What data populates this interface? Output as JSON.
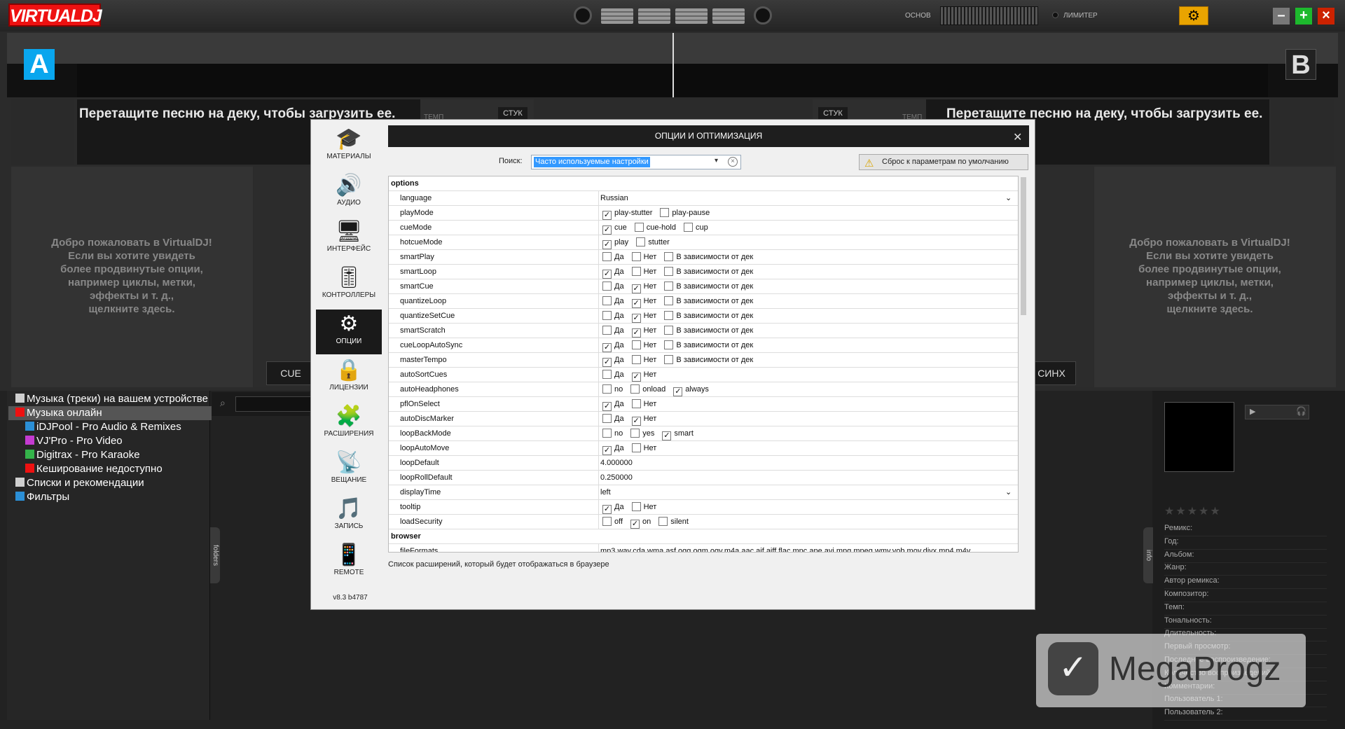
{
  "app": {
    "logo": "VIRTUALDJ",
    "master_label": "ОСНОВ",
    "limiter_label": "ЛИМИТЕР"
  },
  "decks": {
    "a_label": "A",
    "b_label": "B",
    "drag_text": "Перетащите песню на деку, чтобы загрузить ее.",
    "tempo_label": "ТЕМП",
    "stuck_label": "СТУК",
    "welcome_text": [
      "Добро пожаловать в VirtualDJ!",
      "Если вы хотите увидеть",
      "более продвинутые опции,",
      "например циклы, метки,",
      "эффекты и т. д.,",
      "щелкните здесь."
    ],
    "cue_label": "CUE",
    "sync_label": "СИНХ"
  },
  "browser": {
    "tree": [
      {
        "label": "Музыка (треки) на вашем устройстве",
        "color": "#cfcfcf"
      },
      {
        "label": "Музыка онлайн",
        "color": "#e11",
        "selected": true
      },
      {
        "label": "iDJPool - Pro Audio & Remixes",
        "color": "#2b8fd6"
      },
      {
        "label": "VJ'Pro - Pro Video",
        "color": "#c43bd1"
      },
      {
        "label": "Digitrax - Pro Karaoke",
        "color": "#34b34a"
      },
      {
        "label": "Кеширование недоступно",
        "color": "#e11"
      },
      {
        "label": "Списки и рекомендации",
        "color": "#cfcfcf"
      },
      {
        "label": "Фильтры",
        "color": "#2b8fd6"
      }
    ],
    "folders_tab": "folders",
    "info_tab": "info"
  },
  "info_panel": {
    "fields": [
      "Ремикс:",
      "Год:",
      "Альбом:",
      "Жанр:",
      "Автор ремикса:",
      "Композитор:",
      "Темп:",
      "Тональность:",
      "Длительность:",
      "Первый просмотр:",
      "Последнее воспроизведение:",
      "Количество воспроизведений:",
      "Комментарии:",
      "Пользователь 1:",
      "Пользователь 2:"
    ]
  },
  "dialog": {
    "title": "ОПЦИИ И ОПТИМИЗАЦИЯ",
    "search_label": "Поиск:",
    "search_value": "Часто используемые настройки",
    "reset_label": "Сброс к параметрам по умолчанию",
    "sidebar": [
      {
        "label": "МАТЕРИАЛЫ",
        "icon": "graduation-cap-icon",
        "glyph": "🎓"
      },
      {
        "label": "АУДИО",
        "icon": "speaker-icon",
        "glyph": "🔊"
      },
      {
        "label": "ИНТЕРФЕЙС",
        "icon": "monitor-icon",
        "glyph": "🖥"
      },
      {
        "label": "КОНТРОЛЛЕРЫ",
        "icon": "mixer-sliders-icon",
        "glyph": "🎚"
      },
      {
        "label": "ОПЦИИ",
        "icon": "gear-icon",
        "glyph": "⚙",
        "active": true
      },
      {
        "label": "ЛИЦЕНЗИИ",
        "icon": "lock-icon",
        "glyph": "🔒"
      },
      {
        "label": "РАСШИРЕНИЯ",
        "icon": "puzzle-icon",
        "glyph": "🧩"
      },
      {
        "label": "ВЕЩАНИЕ",
        "icon": "broadcast-icon",
        "glyph": "📡"
      },
      {
        "label": "ЗАПИСЬ",
        "icon": "music-folder-icon",
        "glyph": "🎵"
      },
      {
        "label": "REMOTE",
        "icon": "phone-icon",
        "glyph": "📱"
      }
    ],
    "version": "v8.3 b4787",
    "rows": [
      {
        "type": "header",
        "key": "options"
      },
      {
        "key": "language",
        "text": "Russian",
        "dropdown": true
      },
      {
        "key": "playMode",
        "opts": [
          [
            "play-stutter",
            true
          ],
          [
            "play-pause",
            false
          ]
        ]
      },
      {
        "key": "cueMode",
        "opts": [
          [
            "cue",
            true
          ],
          [
            "cue-hold",
            false
          ],
          [
            "cup",
            false
          ]
        ]
      },
      {
        "key": "hotcueMode",
        "opts": [
          [
            "play",
            true
          ],
          [
            "stutter",
            false
          ]
        ]
      },
      {
        "key": "smartPlay",
        "opts": [
          [
            "Да",
            false
          ],
          [
            "Нет",
            false
          ],
          [
            "В зависимости от дек",
            false
          ]
        ]
      },
      {
        "key": "smartLoop",
        "opts": [
          [
            "Да",
            true
          ],
          [
            "Нет",
            false
          ],
          [
            "В зависимости от дек",
            false
          ]
        ]
      },
      {
        "key": "smartCue",
        "opts": [
          [
            "Да",
            false
          ],
          [
            "Нет",
            true
          ],
          [
            "В зависимости от дек",
            false
          ]
        ]
      },
      {
        "key": "quantizeLoop",
        "opts": [
          [
            "Да",
            false
          ],
          [
            "Нет",
            true
          ],
          [
            "В зависимости от дек",
            false
          ]
        ]
      },
      {
        "key": "quantizeSetCue",
        "opts": [
          [
            "Да",
            false
          ],
          [
            "Нет",
            true
          ],
          [
            "В зависимости от дек",
            false
          ]
        ]
      },
      {
        "key": "smartScratch",
        "opts": [
          [
            "Да",
            false
          ],
          [
            "Нет",
            true
          ],
          [
            "В зависимости от дек",
            false
          ]
        ]
      },
      {
        "key": "cueLoopAutoSync",
        "opts": [
          [
            "Да",
            true
          ],
          [
            "Нет",
            false
          ],
          [
            "В зависимости от дек",
            false
          ]
        ]
      },
      {
        "key": "masterTempo",
        "opts": [
          [
            "Да",
            true
          ],
          [
            "Нет",
            false
          ],
          [
            "В зависимости от дек",
            false
          ]
        ]
      },
      {
        "key": "autoSortCues",
        "opts": [
          [
            "Да",
            false
          ],
          [
            "Нет",
            true
          ]
        ]
      },
      {
        "key": "autoHeadphones",
        "opts": [
          [
            "no",
            false
          ],
          [
            "onload",
            false
          ],
          [
            "always",
            true
          ]
        ]
      },
      {
        "key": "pflOnSelect",
        "opts": [
          [
            "Да",
            true
          ],
          [
            "Нет",
            false
          ]
        ]
      },
      {
        "key": "autoDiscMarker",
        "opts": [
          [
            "Да",
            false
          ],
          [
            "Нет",
            true
          ]
        ]
      },
      {
        "key": "loopBackMode",
        "opts": [
          [
            "no",
            false
          ],
          [
            "yes",
            false
          ],
          [
            "smart",
            true
          ]
        ]
      },
      {
        "key": "loopAutoMove",
        "opts": [
          [
            "Да",
            true
          ],
          [
            "Нет",
            false
          ]
        ]
      },
      {
        "key": "loopDefault",
        "text": "4.000000"
      },
      {
        "key": "loopRollDefault",
        "text": "0.250000"
      },
      {
        "key": "displayTime",
        "text": "left",
        "dropdown": true
      },
      {
        "key": "tooltip",
        "opts": [
          [
            "Да",
            true
          ],
          [
            "Нет",
            false
          ]
        ]
      },
      {
        "key": "loadSecurity",
        "opts": [
          [
            "off",
            false
          ],
          [
            "on",
            true
          ],
          [
            "silent",
            false
          ]
        ]
      },
      {
        "type": "header",
        "key": "browser"
      },
      {
        "key": "fileFormats",
        "text": "mp3,wav,cda,wma,asf,ogg,ogm,ogv,m4a,aac,aif,aiff,flac,mpc,ape,avi,mpg,mpeg,wmv,vob,mov,divx,mp4,m4v"
      }
    ],
    "description": "Список расширений, который будет отображаться в браузере"
  },
  "watermark": "MegaProgz"
}
